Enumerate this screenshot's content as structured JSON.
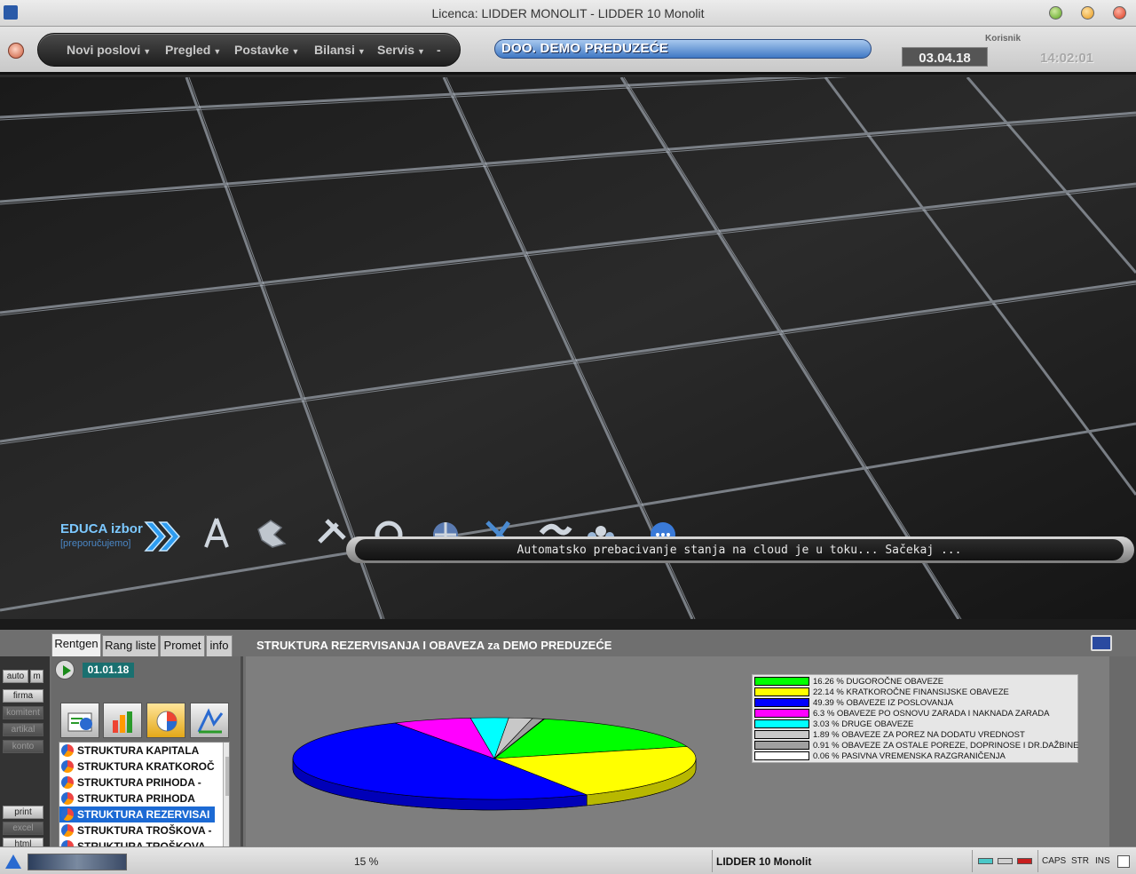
{
  "window": {
    "title": "Licenca: LIDDER MONOLIT - LIDDER 10 Monolit"
  },
  "menubar": {
    "items": [
      "Novi poslovi",
      "Pregled",
      "Postavke",
      "Bilansi",
      "Servis",
      "-"
    ],
    "company": "DOO. DEMO PREDUZEĆE",
    "user_label": "Korisnik",
    "date": "03.04.18",
    "time": "14:02:01"
  },
  "desktop": {
    "educa_title": "EDUCA izbor",
    "educa_subtitle": "[preporučujemo]",
    "dock_icons": [
      "compass-icon",
      "connector-icon",
      "tools-icon",
      "ring-icon",
      "ball-icon",
      "scissors-icon",
      "handshake-icon",
      "people-icon",
      "chat-icon"
    ],
    "cloud_message": "Automatsko prebacivanje stanja na cloud je u toku... Sačekaj ..."
  },
  "panel": {
    "tabs": [
      "Rentgen",
      "Rang liste",
      "Promet",
      "info"
    ],
    "active_tab": "Rentgen",
    "title": "STRUKTURA REZERVISANJA I OBAVEZA za DEMO PREDUZEĆE",
    "left_buttons": {
      "auto": "auto",
      "m": "m",
      "firma": "firma",
      "komitent": "komitent",
      "artikal": "artikal",
      "konto": "konto",
      "print": "print",
      "excel": "excel",
      "html": "html"
    },
    "date": "01.01.18",
    "list": [
      "STRUKTURA KAPITALA",
      "STRUKTURA KRATKOROČ",
      "STRUKTURA PRIHODA -",
      "STRUKTURA PRIHODA",
      "STRUKTURA REZERVISAI",
      "STRUKTURA TROŠKOVA -",
      "STRUKTURA TROŠKOVA"
    ],
    "selected_index": 4
  },
  "chart_data": {
    "type": "pie",
    "title": "STRUKTURA REZERVISANJA I OBAVEZA za DEMO PREDUZEĆE",
    "labels": [
      "DUGOROČNE OBAVEZE",
      "KRATKOROČNE FINANSIJSKE OBAVEZE",
      "OBAVEZE IZ POSLOVANJA",
      "OBAVEZE PO OSNOVU ZARADA I NAKNADA ZARADA",
      "DRUGE OBAVEZE",
      "OBAVEZE ZA POREZ NA DODATU VREDNOST",
      "OBAVEZE ZA OSTALE POREZE, DOPRINOSE I DR.DAŽBINE",
      "PASIVNA VREMENSKA RAZGRANIČENJA"
    ],
    "values": [
      16.26,
      22.14,
      49.39,
      6.3,
      3.03,
      1.89,
      0.91,
      0.06
    ],
    "legend_text": [
      "16.26 % DUGOROČNE OBAVEZE",
      "22.14 % KRATKOROČNE FINANSIJSKE OBAVEZE",
      "49.39 % OBAVEZE IZ POSLOVANJA",
      "6.3 % OBAVEZE PO OSNOVU ZARADA I NAKNADA ZARADA",
      "3.03 % DRUGE OBAVEZE",
      "1.89 % OBAVEZE ZA POREZ NA DODATU VREDNOST",
      "0.91 % OBAVEZE ZA OSTALE POREZE, DOPRINOSE I DR.DAŽBINE",
      "0.06 % PASIVNA VREMENSKA RAZGRANIČENJA"
    ],
    "colors": [
      "#00ff00",
      "#ffff00",
      "#0000ff",
      "#ff00ff",
      "#00ffff",
      "#c8c8c8",
      "#a0a0a0",
      "#ffffff"
    ],
    "legend_position": "right",
    "style": "3d-pie"
  },
  "statusbar": {
    "progress_percent": "15 %",
    "app_name": "LIDDER 10 Monolit",
    "caps": "CAPS",
    "str": "STR",
    "ins": "INS"
  }
}
